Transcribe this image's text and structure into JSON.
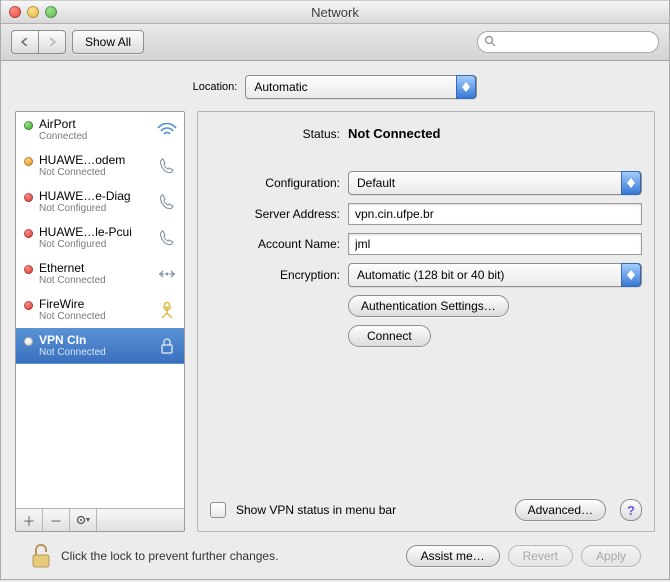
{
  "window": {
    "title": "Network"
  },
  "toolbar": {
    "show_all": "Show All",
    "search_placeholder": ""
  },
  "location": {
    "label": "Location:",
    "value": "Automatic"
  },
  "sidebar": {
    "items": [
      {
        "name": "AirPort",
        "status": "Connected",
        "icon": "wifi-icon",
        "dot": "green"
      },
      {
        "name": "HUAWE…odem",
        "status": "Not Connected",
        "icon": "phone-icon",
        "dot": "orange"
      },
      {
        "name": "HUAWE…e-Diag",
        "status": "Not Configured",
        "icon": "phone-icon",
        "dot": "red"
      },
      {
        "name": "HUAWE…le-Pcui",
        "status": "Not Configured",
        "icon": "phone-icon",
        "dot": "red"
      },
      {
        "name": "Ethernet",
        "status": "Not Connected",
        "icon": "ethernet-icon",
        "dot": "red"
      },
      {
        "name": "FireWire",
        "status": "Not Connected",
        "icon": "firewire-icon",
        "dot": "red"
      },
      {
        "name": "VPN CIn",
        "status": "Not Connected",
        "icon": "lock-icon",
        "dot": "white",
        "selected": true
      }
    ],
    "actions": {
      "add": "+",
      "remove": "-",
      "gear": "gear-icon"
    }
  },
  "detail": {
    "status": {
      "label": "Status:",
      "value": "Not Connected"
    },
    "configuration": {
      "label": "Configuration:",
      "value": "Default"
    },
    "server": {
      "label": "Server Address:",
      "value": "vpn.cin.ufpe.br"
    },
    "account": {
      "label": "Account Name:",
      "value": "jml"
    },
    "encryption": {
      "label": "Encryption:",
      "value": "Automatic (128 bit or 40 bit)"
    },
    "auth_button": "Authentication Settings…",
    "connect_button": "Connect",
    "show_status_checked": false,
    "show_status_label": "Show VPN status in menu bar",
    "advanced_button": "Advanced…"
  },
  "footer": {
    "lock_text": "Click the lock to prevent further changes.",
    "assist": "Assist me…",
    "revert": "Revert",
    "apply": "Apply"
  }
}
